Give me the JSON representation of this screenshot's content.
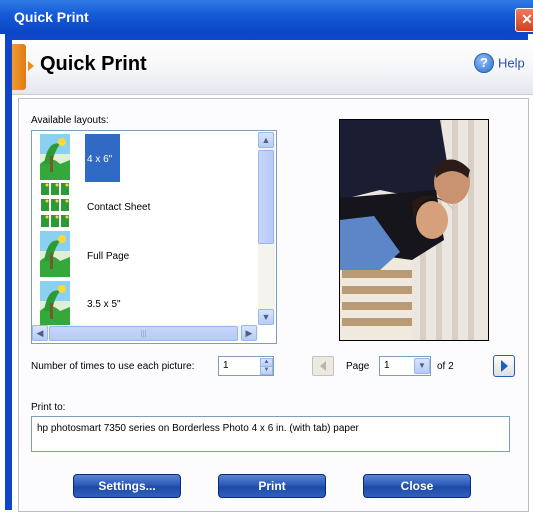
{
  "window": {
    "title": "Quick Print",
    "close_symbol": "✕"
  },
  "header": {
    "title": "Quick Print",
    "help_label": "Help",
    "help_icon": "question-icon"
  },
  "layouts": {
    "label": "Available layouts:",
    "items": [
      {
        "label": "4 x 6\"",
        "icon": "single-photo-icon",
        "selected": true
      },
      {
        "label": "Contact Sheet",
        "icon": "contact-sheet-icon",
        "selected": false
      },
      {
        "label": "Full Page",
        "icon": "single-photo-icon",
        "selected": false
      },
      {
        "label": "3.5 x 5\"",
        "icon": "single-photo-icon",
        "selected": false
      }
    ]
  },
  "copies": {
    "label": "Number of times to use each picture:",
    "value": "1"
  },
  "pager": {
    "page_label": "Page",
    "current": "1",
    "of_label": "of 2"
  },
  "print_to": {
    "label": "Print to:",
    "value": "hp photosmart 7350 series on Borderless Photo 4 x 6 in. (with tab) paper"
  },
  "buttons": {
    "settings": "Settings...",
    "print": "Print",
    "close": "Close"
  },
  "colors": {
    "accent": "#0b45c4",
    "selection": "#316ac5",
    "orange_tab": "#f08a1c"
  }
}
